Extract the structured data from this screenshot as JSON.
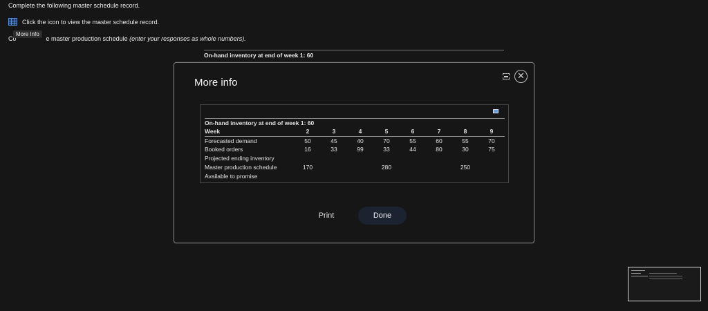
{
  "background": {
    "instruction_1": "Complete the following master schedule record.",
    "instruction_2": "Click the icon to view the master schedule record.",
    "instruction_3_start": "Co",
    "instruction_3_end": "e master production schedule",
    "instruction_3_italic": "(enter your responses as whole numbers).",
    "tooltip": "More Info",
    "table_title": "On-hand inventory at end of week 1: 60"
  },
  "modal": {
    "title": "More info",
    "table": {
      "title": "On-hand inventory at end of week 1: 60",
      "header_label": "Week",
      "weeks": [
        "2",
        "3",
        "4",
        "5",
        "6",
        "7",
        "8",
        "9"
      ],
      "rows": [
        {
          "label": "Forecasted demand",
          "values": [
            "50",
            "45",
            "40",
            "70",
            "55",
            "60",
            "55",
            "70"
          ]
        },
        {
          "label": "Booked orders",
          "values": [
            "16",
            "33",
            "99",
            "33",
            "44",
            "80",
            "30",
            "75"
          ]
        },
        {
          "label": "Projected ending inventory",
          "values": [
            "",
            "",
            "",
            "",
            "",
            "",
            "",
            ""
          ]
        },
        {
          "label": "Master production schedule",
          "values": [
            "170",
            "",
            "",
            "280",
            "",
            "",
            "250",
            ""
          ]
        },
        {
          "label": "Available to promise",
          "values": [
            "",
            "",
            "",
            "",
            "",
            "",
            "",
            ""
          ]
        }
      ]
    },
    "print_label": "Print",
    "done_label": "Done"
  },
  "icons": {
    "grid": "table-grid-icon",
    "maximize": "maximize-icon",
    "close": "close-icon",
    "copy": "copy-icon"
  }
}
